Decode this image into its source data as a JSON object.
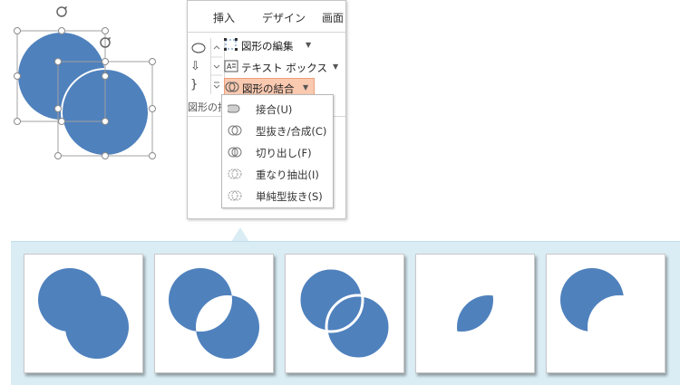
{
  "ribbon": {
    "tabs": [
      "挿入",
      "デザイン",
      "画面"
    ],
    "commands": {
      "edit_shape": "図形の編集",
      "text_box": "テキスト ボックス",
      "merge_shapes": "図形の結合"
    },
    "group_label": "図形の挿"
  },
  "dropdown": {
    "items": [
      "接合(U)",
      "型抜き/合成(C)",
      "切り出し(F)",
      "重なり抽出(I)",
      "単純型抜き(S)"
    ]
  },
  "colors": {
    "shape_fill": "#4f81bd",
    "highlight": "#f9c9b0",
    "strip_bg": "#daedf4"
  },
  "icons": [
    "rotate-handle-icon",
    "oval-icon",
    "down-arrow-icon",
    "brace-icon",
    "edit-points-icon",
    "text-box-icon",
    "merge-shapes-icon"
  ]
}
